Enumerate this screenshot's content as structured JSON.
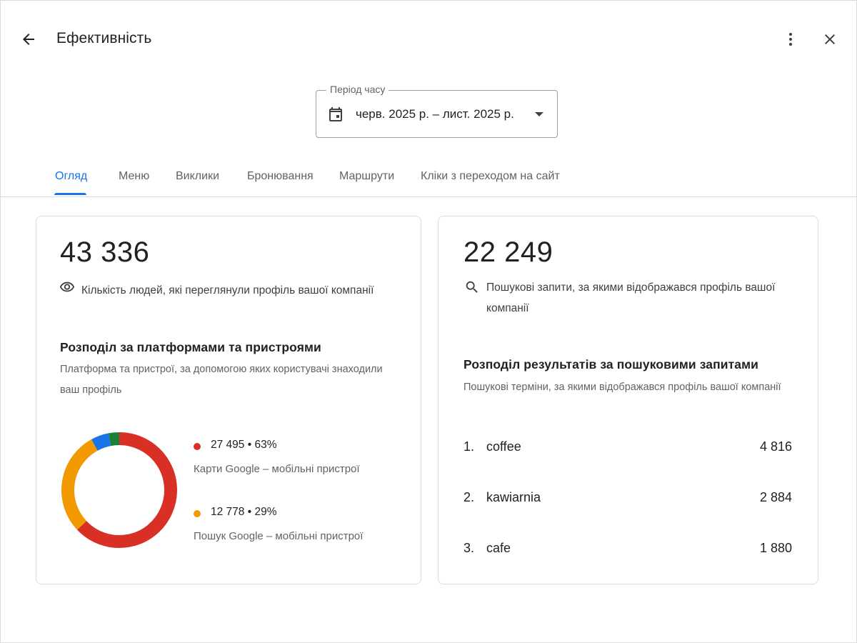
{
  "header": {
    "title": "Ефективність"
  },
  "period": {
    "label": "Період часу",
    "value": "черв. 2025 р. – лист. 2025 р."
  },
  "tabs": [
    {
      "label": "Огляд",
      "active": true
    },
    {
      "label": "Меню",
      "active": false
    },
    {
      "label": "Виклики",
      "active": false
    },
    {
      "label": "Бронювання",
      "active": false
    },
    {
      "label": "Маршрути",
      "active": false
    },
    {
      "label": "Кліки з переходом на сайт",
      "active": false
    }
  ],
  "views_card": {
    "total": "43 336",
    "icon": "eye-icon",
    "description": "Кількість людей, які переглянули профіль вашої компанії",
    "breakdown_title": "Розподіл за платформами та пристроями",
    "breakdown_subtitle_line1": "Платформа та пристрої, за допомогою яких користувачі знаходили",
    "breakdown_subtitle_line2": "ваш профіль",
    "legend": [
      {
        "value": "27 495 • 63%",
        "label": "Карти Google – мобільні пристрої",
        "color": "#d93025"
      },
      {
        "value": "12 778 • 29%",
        "label": "Пошук Google – мобільні пристрої",
        "color": "#f29900"
      }
    ]
  },
  "chart_data": {
    "type": "pie",
    "donut": true,
    "slices": [
      {
        "label": "Карти Google – мобільні пристрої",
        "value": 27495,
        "percent": 63,
        "color": "#d93025"
      },
      {
        "label": "Пошук Google – мобільні пристрої",
        "value": 12778,
        "percent": 29,
        "color": "#f29900"
      },
      {
        "label": "",
        "percent": 5,
        "color": "#1a73e8"
      },
      {
        "label": "",
        "percent": 3,
        "color": "#188038"
      }
    ]
  },
  "search_card": {
    "total": "22 249",
    "icon": "search-icon",
    "description_line1": "Пошукові запити, за якими відображався профіль вашої",
    "description_line2": "компанії",
    "breakdown_title": "Розподіл результатів за пошуковими запитами",
    "breakdown_subtitle": "Пошукові терміни, за якими відображався профіль вашої компанії",
    "terms": [
      {
        "rank": "1.",
        "term": "coffee",
        "count": "4 816"
      },
      {
        "rank": "2.",
        "term": "kawiarnia",
        "count": "2 884"
      },
      {
        "rank": "3.",
        "term": "cafe",
        "count": "1 880"
      }
    ]
  }
}
